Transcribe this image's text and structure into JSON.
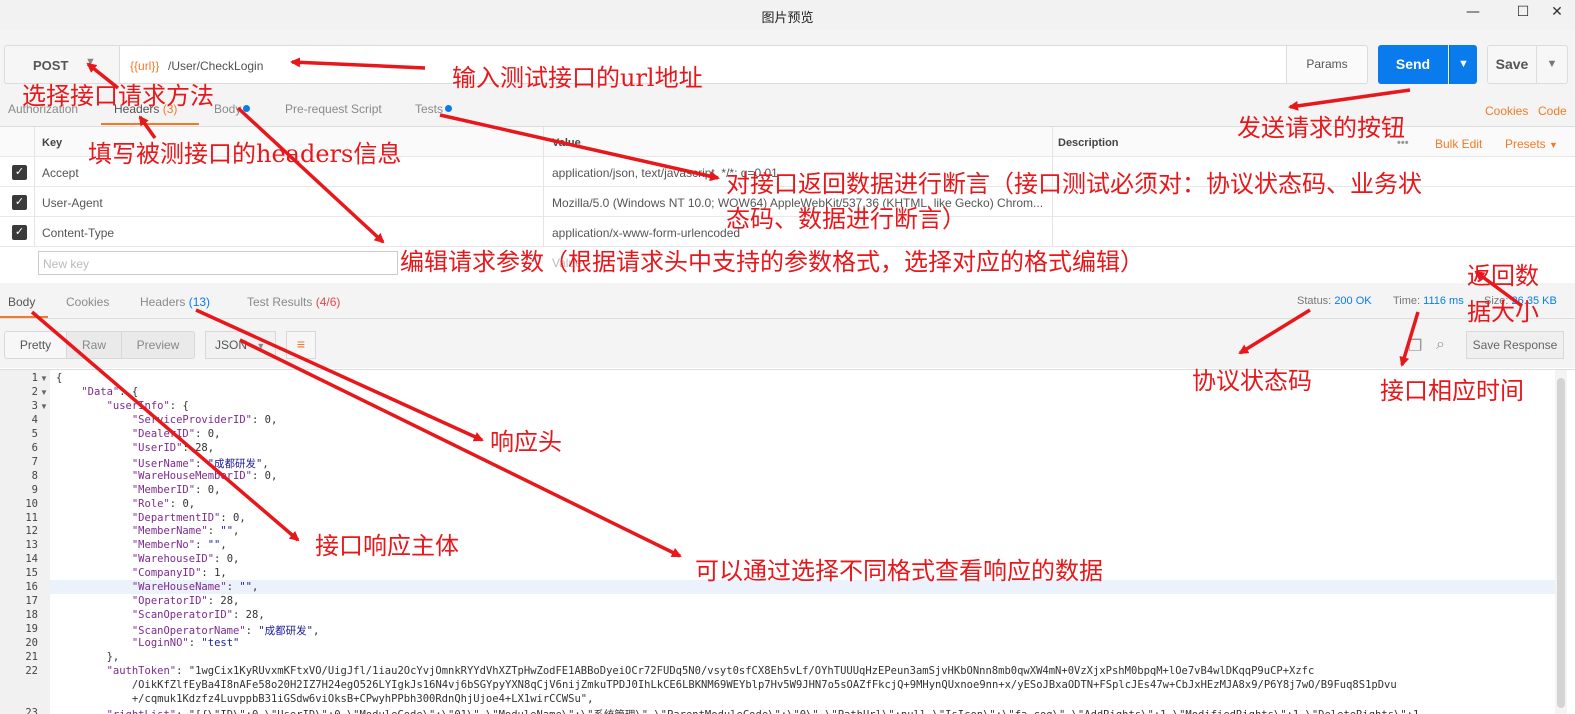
{
  "window": {
    "title": "图片预览",
    "minimize": "—",
    "maximize": "☐",
    "close": "✕"
  },
  "request": {
    "method": "POST",
    "url_variable": "{{url}}",
    "url_path": "/User/CheckLogin",
    "params_label": "Params",
    "send_label": "Send",
    "save_label": "Save"
  },
  "request_tabs": {
    "authorization": "Authorization",
    "headers": "Headers",
    "headers_count": "(3)",
    "body": "Body",
    "pre_request": "Pre-request Script",
    "tests": "Tests",
    "cookies": "Cookies",
    "code": "Code"
  },
  "headers_table": {
    "col_key": "Key",
    "col_value": "Value",
    "col_description": "Description",
    "more": "•••",
    "bulk_edit": "Bulk Edit",
    "presets": "Presets",
    "rows": [
      {
        "key": "Accept",
        "value": "application/json, text/javascript, */*; q=0.01"
      },
      {
        "key": "User-Agent",
        "value": "Mozilla/5.0 (Windows NT 10.0; WOW64) AppleWebKit/537.36 (KHTML, like Gecko) Chrom..."
      },
      {
        "key": "Content-Type",
        "value": "application/x-www-form-urlencoded"
      }
    ],
    "new_key_placeholder": "New key",
    "new_value_placeholder": "Value"
  },
  "response_tabs": {
    "body": "Body",
    "cookies": "Cookies",
    "headers": "Headers",
    "headers_count": "(13)",
    "test_results": "Test Results",
    "test_results_count": "(4/6)"
  },
  "response_status": {
    "status_label": "Status:",
    "status_value": "200 OK",
    "time_label": "Time:",
    "time_value": "1116 ms",
    "size_label": "Size:",
    "size_value": "26.35 KB"
  },
  "response_tools": {
    "pretty": "Pretty",
    "raw": "Raw",
    "preview": "Preview",
    "format": "JSON",
    "save_response": "Save Response"
  },
  "code_lines": [
    "{",
    "    \"Data\": {",
    "        \"userInfo\": {",
    "            \"ServiceProviderID\": 0,",
    "            \"DealerID\": 0,",
    "            \"UserID\": 28,",
    "            \"UserName\": \"成都研发\",",
    "            \"WareHouseMemberID\": 0,",
    "            \"MemberID\": 0,",
    "            \"Role\": 0,",
    "            \"DepartmentID\": 0,",
    "            \"MemberName\": \"\",",
    "            \"MemberNo\": \"\",",
    "            \"WarehouseID\": 0,",
    "            \"CompanyID\": 1,",
    "            \"WareHouseName\": \"\",",
    "            \"OperatorID\": 28,",
    "            \"ScanOperatorID\": 28,",
    "            \"ScanOperatorName\": \"成都研发\",",
    "            \"LoginNO\": \"test\"",
    "        },",
    "        \"authToken\": \"1wgCix1KyRUvxmKFtxVO/UigJfl/1iau2OcYvjOmnkRYYdVhXZTpHwZodFE1ABBoDyeiOCr72FUDq5N0/vsyt0sfCX8Eh5vLf/OYhTUUUqHzEPeun3amSjvHKbONnn8mb0qwXW4mN+0VzXjxPshM0bpqM+lOe7vB4wlDKqqP9uCP+Xzfc",
    "            /OikKfZlfEyBa4I8nAFe58o20H2IZ7H24egO526LYIgkJs16N4vj6bSGYpyYXN8qCjV6nijZmkuTPDJ0IhLkCE6LBKNM69WEYblp7Hv5W9JHN7o5sOAZfFkcjQ+9MHynQUxnoe9nn+x/yESoJBxaODTN+FSplcJEs47w+CbJxHEzMJA8x9/P6Y8j7wO/B9Fuq8S1pDvu",
    "            +/cqmuk1Kdzfz4LuvppbB31iGSdw6viOksB+CPwyhPPbh300RdnQhjUjoe4+LX1wirCCWSu\",",
    "        \"rightList\": \"[{\\\"ID\\\":0,\\\"UserID\\\":0,\\\"ModuleCode\\\":\\\"01\\\",\\\"ModuleName\\\":\\\"系统管理\\\",\\\"ParentModuleCode\\\":\\\"0\\\",\\\"PathUrl\\\":null,\\\"IsIcon\\\":\\\"fa-cog\\\",\\\"AddRights\\\":1,\\\"ModifiedRights\\\":1,\\\"DeleteRights\\\":1"
  ],
  "code_line_numbers": [
    "1",
    "2",
    "3",
    "4",
    "5",
    "6",
    "7",
    "8",
    "9",
    "10",
    "11",
    "12",
    "13",
    "14",
    "15",
    "16",
    "17",
    "18",
    "19",
    "20",
    "21",
    "22",
    "",
    "",
    "23"
  ],
  "annotations": {
    "select_method": "选择接口请求方法",
    "input_url": "输入测试接口的url地址",
    "send_button": "发送请求的按钮",
    "fill_headers": "填写被测接口的headers信息",
    "assert_line1": "对接口返回数据进行断言（接口测试必须对：协议状态码、业务状",
    "assert_line2": "态码、数据进行断言）",
    "edit_params": "编辑请求参数（根据请求头中支持的参数格式，选择对应的格式编辑）",
    "size_line1": "返回数",
    "size_line2": "据大小",
    "status_code": "协议状态码",
    "response_time": "接口相应时间",
    "response_headers": "响应头",
    "response_body": "接口响应主体",
    "view_formats": "可以通过选择不同格式查看响应的数据"
  },
  "colors": {
    "accent_orange": "#f37a28",
    "send_blue": "#097bed",
    "annotation_red": "#e8171b"
  }
}
